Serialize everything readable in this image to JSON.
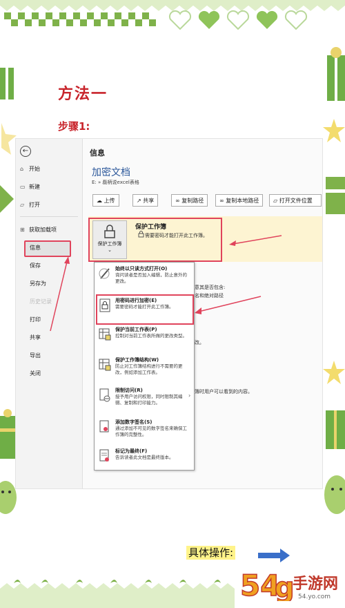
{
  "title": "方法一",
  "step": "步骤1:",
  "operation_label": "具体操作:",
  "logo": {
    "number": "54",
    "extra": "g",
    "text": "手游网",
    "domain": "54.yo.com"
  },
  "colors": {
    "accent_red": "#c8242b",
    "highlight_red": "#e0435b",
    "word_blue": "#2b579a",
    "yellow_band": "#fdf4d2"
  },
  "sidebar": {
    "items": [
      {
        "icon": "home-icon",
        "label": "开始"
      },
      {
        "icon": "new-icon",
        "label": "新建"
      },
      {
        "icon": "folder-icon",
        "label": "打开"
      },
      {
        "icon": "addin-icon",
        "label": "获取加载项"
      },
      {
        "icon": "",
        "label": "信息"
      },
      {
        "icon": "",
        "label": "保存"
      },
      {
        "icon": "",
        "label": "另存为"
      },
      {
        "icon": "",
        "label": "历史记录"
      },
      {
        "icon": "",
        "label": "打印"
      },
      {
        "icon": "",
        "label": "共享"
      },
      {
        "icon": "",
        "label": "导出"
      },
      {
        "icon": "",
        "label": "关闭"
      }
    ]
  },
  "main": {
    "heading": "信息",
    "doc_title": "加密文档",
    "doc_path": "E: » 磊柄说excel表格",
    "toolbar": [
      "上传",
      "共享",
      "复制路径",
      "复制本地路径",
      "打开文件位置"
    ],
    "protect": {
      "button": "保护工作簿",
      "title": "保护工作簿",
      "desc": "需要密码才能打开此工作簿。"
    },
    "background_text": [
      "意其是否包含:",
      "名和绝对路径",
      "改。",
      "簿时用户可以看到的内容。"
    ]
  },
  "menu": {
    "items": [
      {
        "icon": "pencil-icon",
        "title": "始终以只读方式打开(O)",
        "desc": "询问读者是否加入编辑，防止意外的更改。"
      },
      {
        "icon": "lock-icon",
        "title": "用密码进行加密(E)",
        "desc": "需要密码才能打开此工作簿。"
      },
      {
        "icon": "sheet-icon",
        "title": "保护当前工作表(P)",
        "desc": "控制对当前工作表所做的更改类型。"
      },
      {
        "icon": "sheet-structure-icon",
        "title": "保护工作簿结构(W)",
        "desc": "防止对工作簿结构进行不需要的更改，例如添加工作表。"
      },
      {
        "icon": "restrict-icon",
        "title": "限制访问(R)",
        "desc": "授予用户访问权限，同时限制其编辑、复制和打印能力。"
      },
      {
        "icon": "signature-icon",
        "title": "添加数字签名(S)",
        "desc": "通过添加不可见的数字签名来确保工作簿的完整性。"
      },
      {
        "icon": "final-icon",
        "title": "标记为最终(F)",
        "desc": "告诉读者此文档是最终版本。"
      }
    ]
  }
}
